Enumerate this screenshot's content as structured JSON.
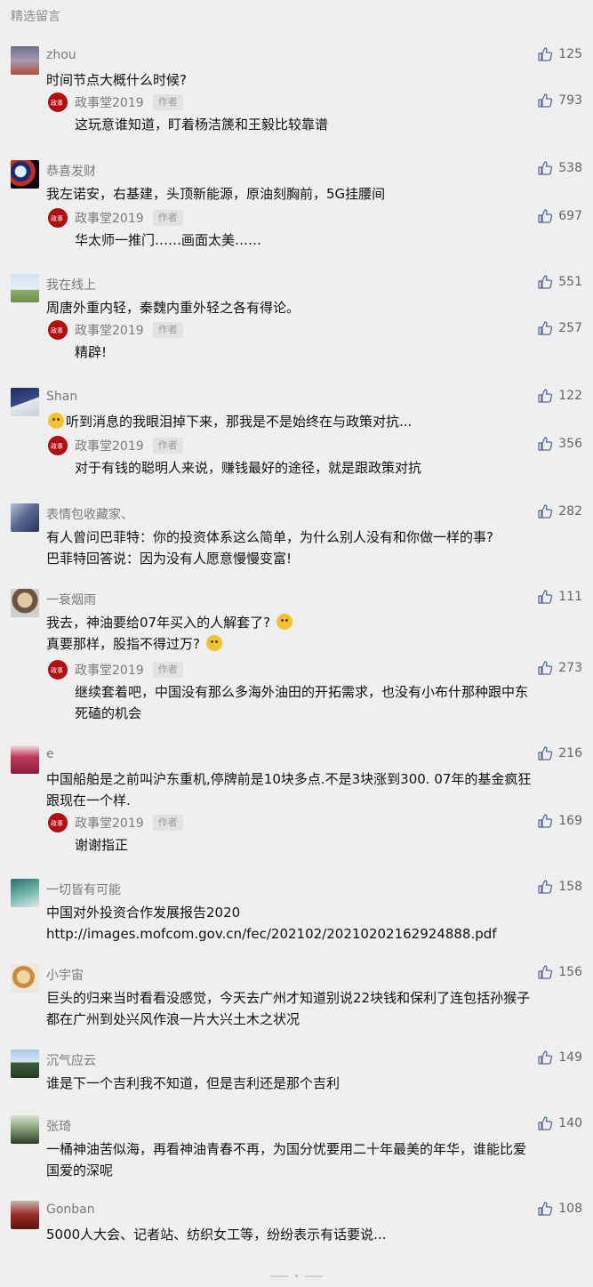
{
  "section_title": "精选留言",
  "comments": [
    {
      "name": "zhou",
      "likes": "125",
      "lines": [
        "时间节点大概什么时候?"
      ],
      "reply": {
        "name": "政事堂2019",
        "badge": "作者",
        "likes": "793",
        "lines": [
          "这玩意谁知道，盯着杨洁篪和王毅比较靠谱"
        ]
      }
    },
    {
      "name": "恭喜发财",
      "likes": "538",
      "lines": [
        "我左诺安，右基建，头顶新能源，原油刻胸前，5G挂腰间"
      ],
      "reply": {
        "name": "政事堂2019",
        "badge": "作者",
        "likes": "697",
        "lines": [
          "华太师一推门……画面太美……"
        ]
      }
    },
    {
      "name": "我在线上",
      "likes": "551",
      "lines": [
        "周唐外重内轻，秦魏内重外轻之各有得论。"
      ],
      "reply": {
        "name": "政事堂2019",
        "badge": "作者",
        "likes": "257",
        "lines": [
          "精辟!"
        ]
      }
    },
    {
      "name": "Shan",
      "likes": "122",
      "lines": [
        "听到消息的我眼泪掉下来，那我是不是始终在与政策对抗..."
      ],
      "reply": {
        "name": "政事堂2019",
        "badge": "作者",
        "likes": "356",
        "lines": [
          "对于有钱的聪明人来说，赚钱最好的途径，就是跟政策对抗"
        ]
      }
    },
    {
      "name": "表情包收藏家、",
      "likes": "282",
      "lines": [
        "有人曾问巴菲特：你的投资体系这么简单，为什么别人没有和你做一样的事?",
        "巴菲特回答说：因为没有人愿意慢慢变富!"
      ]
    },
    {
      "name": "一衰烟雨",
      "likes": "111",
      "lines": [
        "我去，神油要给07年买入的人解套了?",
        "真要那样，股指不得过万?"
      ],
      "reply": {
        "name": "政事堂2019",
        "badge": "作者",
        "likes": "273",
        "lines": [
          "继续套着吧，中国没有那么多海外油田的开拓需求，也没有小布什那种跟中东",
          "死磕的机会"
        ]
      }
    },
    {
      "name": "e",
      "likes": "216",
      "lines": [
        "中国船舶是之前叫沪东重机,停牌前是10块多点.不是3块涨到300.  07年的基金疯狂",
        "跟现在一个样."
      ],
      "reply": {
        "name": "政事堂2019",
        "badge": "作者",
        "likes": "169",
        "lines": [
          "谢谢指正"
        ]
      }
    },
    {
      "name": "一切皆有可能",
      "likes": "158",
      "lines": [
        "中国对外投资合作发展报告2020",
        "http://images.mofcom.gov.cn/fec/202102/20210202162924888.pdf"
      ]
    },
    {
      "name": "小宇宙",
      "likes": "156",
      "lines": [
        "巨头的归来当时看看没感觉，今天去广州才知道别说22块钱和保利了连包括孙猴子",
        "都在广州到处兴风作浪一片大兴土木之状况"
      ]
    },
    {
      "name": "沉气应云",
      "likes": "149",
      "lines": [
        "谁是下一个吉利我不知道，但是吉利还是那个吉利"
      ]
    },
    {
      "name": "张琦",
      "likes": "140",
      "lines": [
        "一桶神油苦似海，再看神油青春不再，为国分忧要用二十年最美的年华，谁能比爱",
        "国爱的深呢"
      ]
    },
    {
      "name": "Gonban",
      "likes": "108",
      "lines": [
        "5000人大会、记者站、纺织女工等，纷纷表示有话要说..."
      ]
    }
  ]
}
